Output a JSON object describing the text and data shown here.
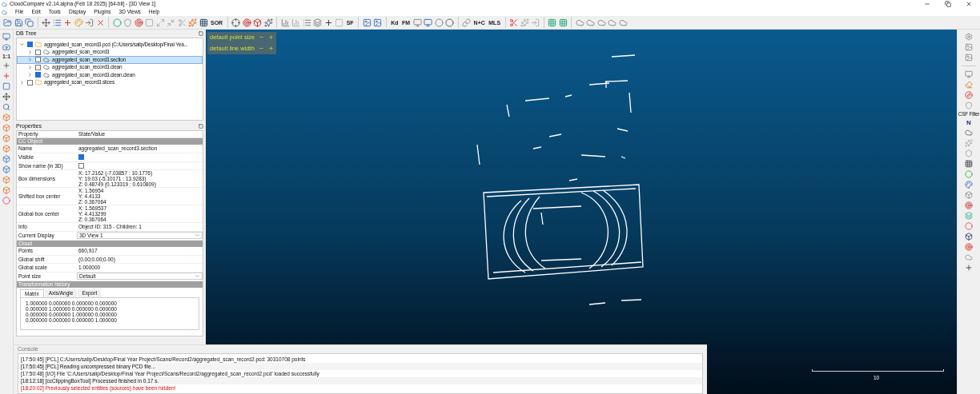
{
  "window": {
    "title": "CloudCompare v2.14.alpha (Feb 18 2025) [64-bit] - [3D View 1]"
  },
  "menu": [
    "File",
    "Edit",
    "Tools",
    "Display",
    "Plugins",
    "3D Views",
    "Help"
  ],
  "toolbar_labels": [
    "SOR",
    "SF",
    "Kd",
    "FM",
    "N+C",
    "MLS"
  ],
  "left_toolbar_label": "1:1",
  "db_tree": {
    "title": "DB Tree",
    "items": [
      {
        "label": "aggregated_scan_record3.pcd (C:/Users/salip/Desktop/Final Yea...",
        "kind": "folder",
        "checked": true,
        "expanded": true,
        "selected": false,
        "children": [
          {
            "label": "aggregated_scan_record3",
            "kind": "cloud",
            "checked": false,
            "expanded": false,
            "selected": false
          },
          {
            "label": "aggregated_scan_record3.section",
            "kind": "cloud",
            "checked": false,
            "expanded": false,
            "selected": true
          },
          {
            "label": "aggregated_scan_record3.clean",
            "kind": "cloud",
            "checked": false,
            "expanded": false,
            "selected": false
          },
          {
            "label": "aggregated_scan_record3.clean.clean",
            "kind": "cloud",
            "checked": true,
            "expanded": false,
            "selected": false
          }
        ]
      },
      {
        "label": "aggregated_scan_record3.slices",
        "kind": "folder",
        "checked": false,
        "expanded": false,
        "selected": false
      }
    ]
  },
  "properties": {
    "title": "Properties",
    "columns": [
      "Property",
      "State/Value"
    ],
    "sections": [
      {
        "title": "CC Object",
        "rows": [
          {
            "kind": "text",
            "name": "Name",
            "value": "aggregated_scan_record3.section"
          },
          {
            "kind": "checkbox",
            "name": "Visible",
            "checked": true
          },
          {
            "kind": "checkbox",
            "name": "Show name (in 3D)",
            "checked": false
          },
          {
            "kind": "lines",
            "name": "Box dimensions",
            "lines": [
              "X: 17.2162 (-7.03857 : 10.1776)",
              "Y: 19.03 (-5.10171 : 13.9283)",
              "Z: 0.48749 (0.123319 : 0.610809)"
            ]
          },
          {
            "kind": "lines",
            "name": "Shifted box center",
            "lines": [
              "X: 1.56954",
              "Y: 4.4133",
              "Z: 0.367064"
            ]
          },
          {
            "kind": "lines",
            "name": "Global box center",
            "lines": [
              "X: 1.569537",
              "Y: 4.413299",
              "Z: 0.367064"
            ]
          },
          {
            "kind": "text",
            "name": "Info",
            "value": "Object ID: 315 - Children: 1"
          },
          {
            "kind": "select",
            "name": "Current Display",
            "value": "3D View 1"
          }
        ]
      },
      {
        "title": "Cloud",
        "rows": [
          {
            "kind": "text",
            "name": "Points",
            "value": "660,917"
          },
          {
            "kind": "text",
            "name": "Global shift",
            "value": "(0.00;0.00;0.00)"
          },
          {
            "kind": "text",
            "name": "Global scale",
            "value": "1.000000"
          },
          {
            "kind": "select",
            "name": "Point size",
            "value": "Default"
          }
        ]
      },
      {
        "title": "Transformation history"
      }
    ],
    "tabs": [
      {
        "label": "Matrix",
        "selected": true
      },
      {
        "label": "Axis/Angle",
        "selected": false
      },
      {
        "label": "Export",
        "selected": false
      }
    ],
    "matrix": [
      "1.000000 0.000000 0.000000 0.000000",
      "0.000000 1.000000 0.000000 0.000000",
      "0.000000 0.000000 1.000000 0.000000",
      "0.000000 0.000000 0.000000 1.000000"
    ]
  },
  "view_overlay": [
    "default point size",
    "default line width"
  ],
  "scale_label": "10",
  "right_toolbar": {
    "label": "CSF Filter",
    "north": "N"
  },
  "console": {
    "title": "Console",
    "lines": [
      {
        "kind": "info",
        "text": "[17:50:45] [PCL] C:/Users/salip/Desktop/Final Year Project/Scans/Record2/aggregated_scan_record2.pcd: 30310708 points"
      },
      {
        "kind": "info",
        "text": "[17:50:45] [PCL] Reading uncompressed binary PCD file..."
      },
      {
        "kind": "info",
        "text": "[17:50:48] [I/O] File 'C:/Users/salip/Desktop/Final Year Project/Scans/Record2/aggregated_scan_record2.pcd' loaded successfully"
      },
      {
        "kind": "info",
        "text": "[18:12:18] [ccClippingBoxTool] Processed finished in 0.17 s."
      },
      {
        "kind": "error",
        "text": "[18:20:02] Previously selected entities (sources) have been hidden!"
      }
    ]
  }
}
